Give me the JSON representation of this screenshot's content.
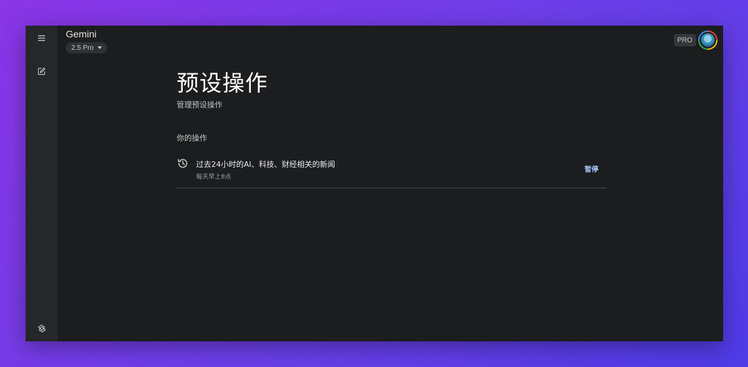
{
  "header": {
    "app_title": "Gemini",
    "model_label": "2.5 Pro",
    "pro_badge": "PRO"
  },
  "sidebar": {
    "icons": [
      "menu-icon",
      "new-chat-icon",
      "settings-icon"
    ]
  },
  "page": {
    "title": "预设操作",
    "subtitle": "管理预设操作",
    "section_label": "你的操作"
  },
  "actions": [
    {
      "title": "过去24小时的AI、科技、财经相关的新闻",
      "schedule": "每天早上8点",
      "button_label": "暂停",
      "icon": "history-icon"
    }
  ],
  "colors": {
    "accent": "#a8c7fa",
    "background": "#1c1d1f",
    "sidebar": "#25272a"
  }
}
